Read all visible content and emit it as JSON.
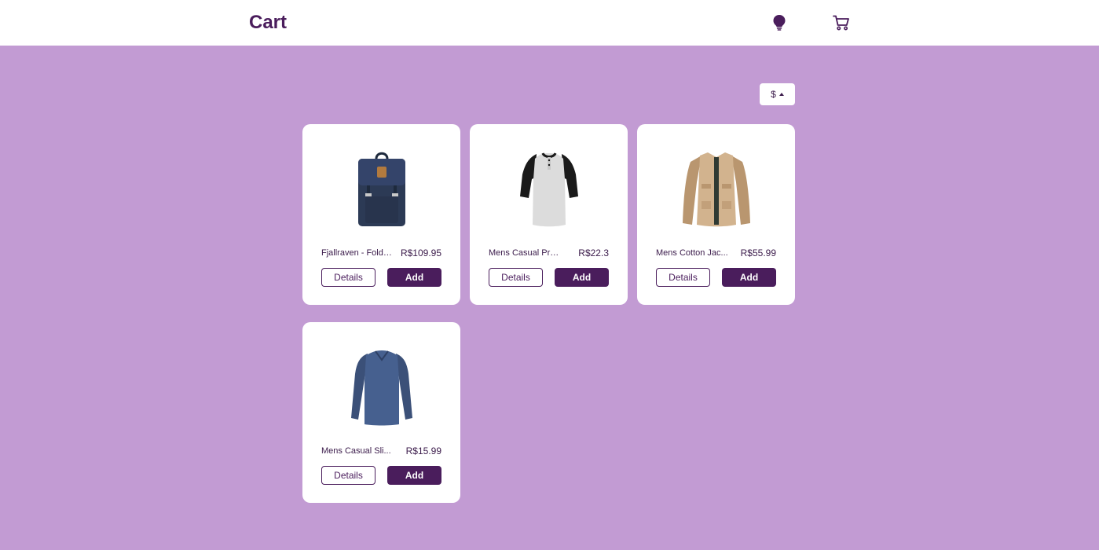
{
  "header": {
    "brand": "Cart",
    "theme_icon": "lightbulb-icon",
    "cart_icon": "shopping-cart-icon"
  },
  "currency": {
    "label": "$",
    "icon": "caret-up-icon"
  },
  "products": [
    {
      "name": "Fjallraven - Folds...",
      "price": "R$109.95",
      "details_label": "Details",
      "add_label": "Add",
      "image": "backpack-image"
    },
    {
      "name": "Mens Casual Pre...",
      "price": "R$22.3",
      "details_label": "Details",
      "add_label": "Add",
      "image": "raglan-tshirt-image"
    },
    {
      "name": "Mens Cotton Jac...",
      "price": "R$55.99",
      "details_label": "Details",
      "add_label": "Add",
      "image": "cotton-jacket-image"
    },
    {
      "name": "Mens Casual Sli...",
      "price": "R$15.99",
      "details_label": "Details",
      "add_label": "Add",
      "image": "longsleeve-shirt-image"
    }
  ],
  "colors": {
    "background": "#c29bd3",
    "brand": "#4a1d5c",
    "card": "#ffffff"
  }
}
